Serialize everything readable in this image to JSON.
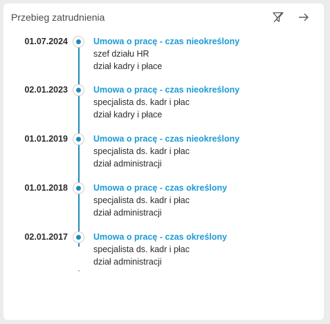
{
  "card": {
    "title": "Przebieg zatrudnienia",
    "icons": {
      "filter": "filter-off-icon",
      "navigate": "arrow-right-icon"
    }
  },
  "colors": {
    "accent": "#1d9ad6",
    "timeline": "#1f8bb8",
    "text": "#2b2b2b",
    "title": "#4a4a4a"
  },
  "entries": [
    {
      "date": "01.07.2024",
      "contract": "Umowa o pracę - czas nieokreślony",
      "position": "szef działu HR",
      "department": "dział kadry i płace"
    },
    {
      "date": "02.01.2023",
      "contract": "Umowa o pracę - czas nieokreślony",
      "position": "specjalista ds. kadr i płac",
      "department": "dział kadry i płace"
    },
    {
      "date": "01.01.2019",
      "contract": "Umowa o pracę - czas nieokreślony",
      "position": "specjalista ds. kadr i płac",
      "department": "dział administracji"
    },
    {
      "date": "01.01.2018",
      "contract": "Umowa o pracę - czas określony",
      "position": "specjalista ds. kadr i płac",
      "department": "dział administracji"
    },
    {
      "date": "02.01.2017",
      "contract": "Umowa o pracę - czas określony",
      "position": "specjalista ds. kadr i płac",
      "department": "dział administracji"
    }
  ]
}
